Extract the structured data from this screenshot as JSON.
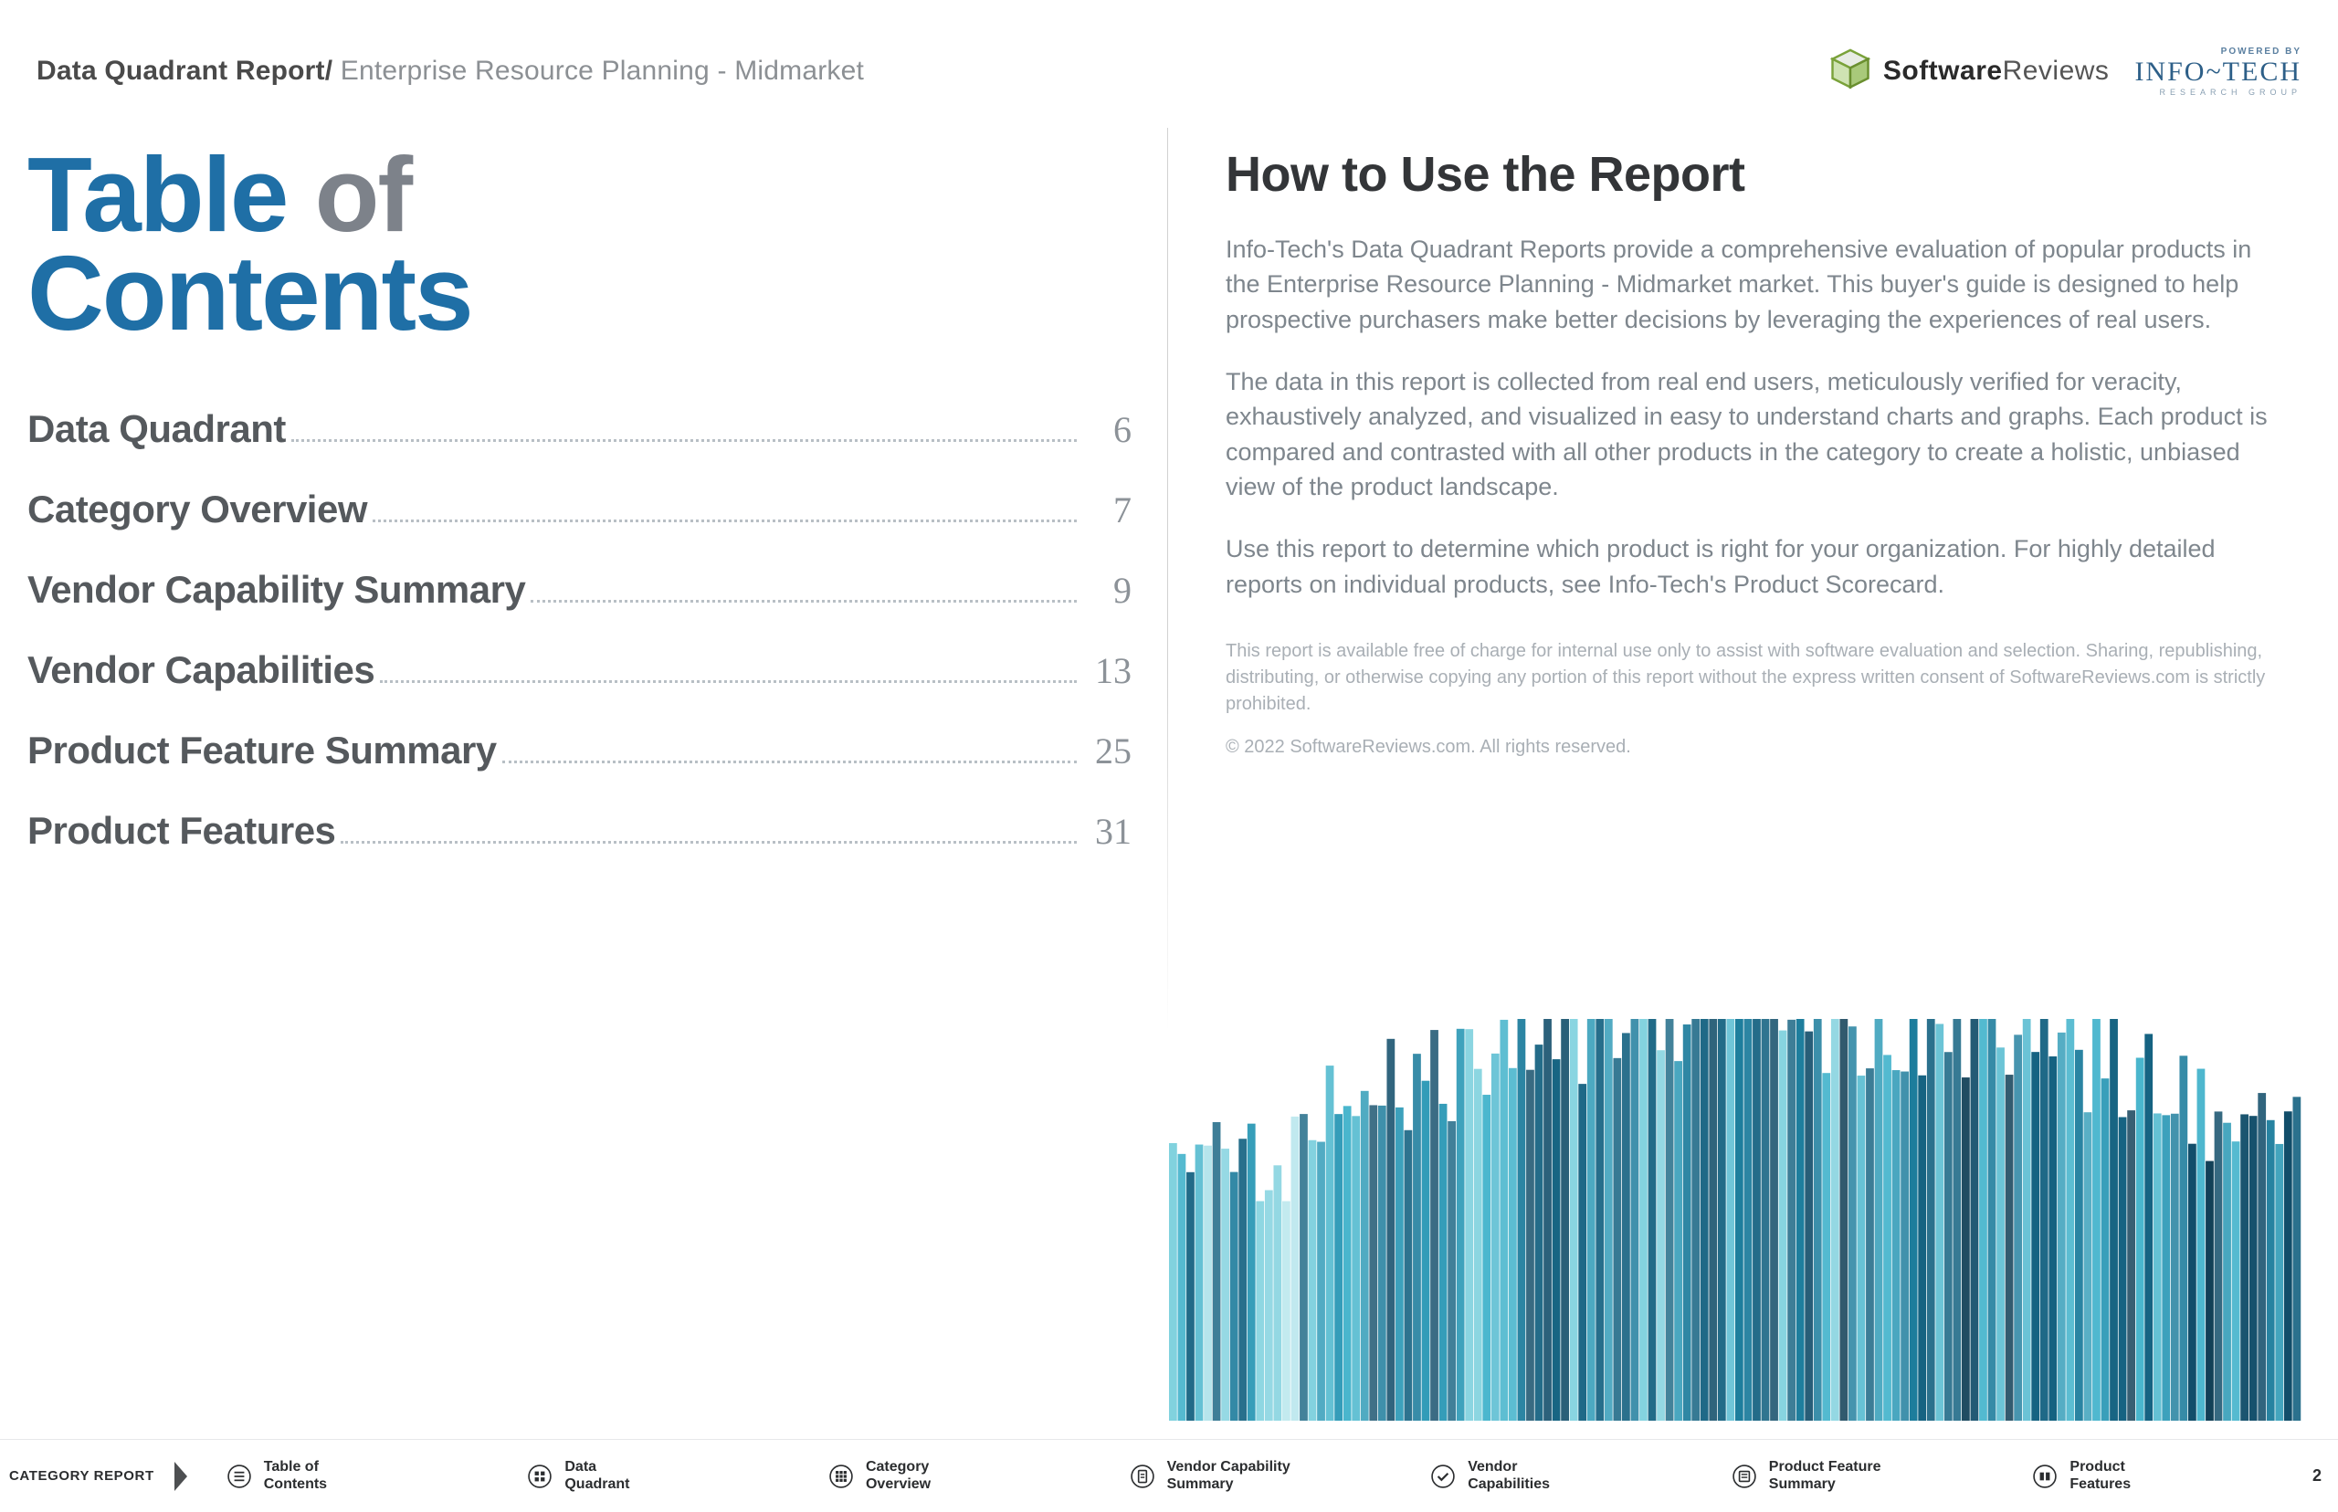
{
  "header": {
    "breadcrumb_main": "Data Quadrant Report/",
    "breadcrumb_sub": " Enterprise Resource Planning - Midmarket",
    "logo_software_reviews_bold": "Software",
    "logo_software_reviews_light": "Reviews",
    "logo_infotech_powered": "POWERED BY",
    "logo_infotech_main": "INFO~TECH",
    "logo_infotech_sub": "RESEARCH GROUP"
  },
  "toc": {
    "title_prefix": "Table ",
    "title_of": "of",
    "title_line2": "Contents",
    "items": [
      {
        "label": "Data Quadrant",
        "page": "6"
      },
      {
        "label": "Category Overview",
        "page": "7"
      },
      {
        "label": "Vendor Capability Summary",
        "page": "9"
      },
      {
        "label": "Vendor Capabilities",
        "page": "13"
      },
      {
        "label": "Product Feature Summary",
        "page": "25"
      },
      {
        "label": "Product Features",
        "page": "31"
      }
    ]
  },
  "howto": {
    "title": "How to Use the Report",
    "p1": "Info-Tech's Data Quadrant Reports provide a comprehensive evaluation of popular products in the Enterprise Resource Planning - Midmarket market. This buyer's guide is designed to help prospective purchasers make better decisions by leveraging the experiences of real users.",
    "p2": "The data in this report is collected from real end users, meticulously verified for veracity, exhaustively analyzed, and visualized in easy to understand charts and graphs. Each product is compared and contrasted with all other products in the category to create a holistic, unbiased view of the product landscape.",
    "p3": "Use this report to determine which product is right for your organization. For highly detailed reports on individual products, see Info-Tech's Product Scorecard."
  },
  "legal": {
    "p1": "This report is available free of charge for internal use only to assist with software evaluation and selection. Sharing, republishing, distributing, or otherwise copying any portion of this report without the express written consent of SoftwareReviews.com is strictly prohibited.",
    "p2": "© 2022 SoftwareReviews.com. All rights reserved."
  },
  "nav": {
    "first": "CATEGORY REPORT",
    "items": [
      "Table of\nContents",
      "Data\nQuadrant",
      "Category\nOverview",
      "Vendor Capability\nSummary",
      "Vendor\nCapabilities",
      "Product Feature\nSummary",
      "Product\nFeatures"
    ],
    "page_number": "2"
  }
}
